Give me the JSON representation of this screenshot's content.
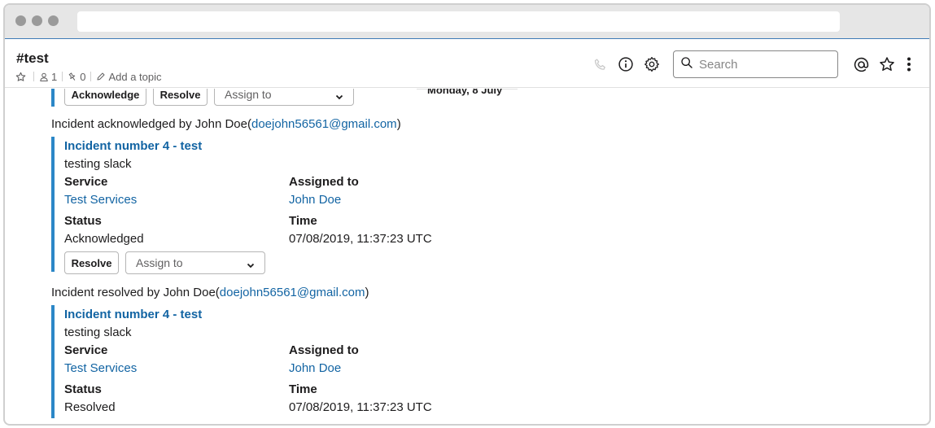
{
  "channel": {
    "name": "#test",
    "members": "1",
    "pins": "0",
    "topic_label": "Add a topic"
  },
  "header_icons": [
    "phone-icon",
    "info-icon",
    "gear-icon",
    "at-icon",
    "star-icon",
    "more-icon"
  ],
  "search": {
    "placeholder": "Search"
  },
  "date_divider": "Monday, 8 July",
  "buttons": {
    "acknowledge": "Acknowledge",
    "resolve": "Resolve",
    "assign_placeholder": "Assign to"
  },
  "messages": [
    {
      "prefix": "Incident acknowledged by John Doe(",
      "email": "doejohn56561@gmail.com",
      "suffix": ")",
      "attachment": {
        "title": "Incident number 4 - test",
        "text": "testing slack",
        "service_label": "Service",
        "service_value": "Test Services",
        "assigned_label": "Assigned to",
        "assigned_value": "John Doe",
        "status_label": "Status",
        "status_value": "Acknowledged",
        "time_label": "Time",
        "time_value": "07/08/2019, 11:37:23 UTC"
      }
    },
    {
      "prefix": "Incident resolved by John Doe(",
      "email": "doejohn56561@gmail.com",
      "suffix": ")",
      "attachment": {
        "title": "Incident number 4 - test",
        "text": "testing slack",
        "service_label": "Service",
        "service_value": "Test Services",
        "assigned_label": "Assigned to",
        "assigned_value": "John Doe",
        "status_label": "Status",
        "status_value": "Resolved",
        "time_label": "Time",
        "time_value": "07/08/2019, 11:37:23 UTC"
      }
    }
  ],
  "colors": {
    "accent_bar": "#2b87c7",
    "link": "#1264a3",
    "browser_chrome": "#e6e6e6"
  }
}
